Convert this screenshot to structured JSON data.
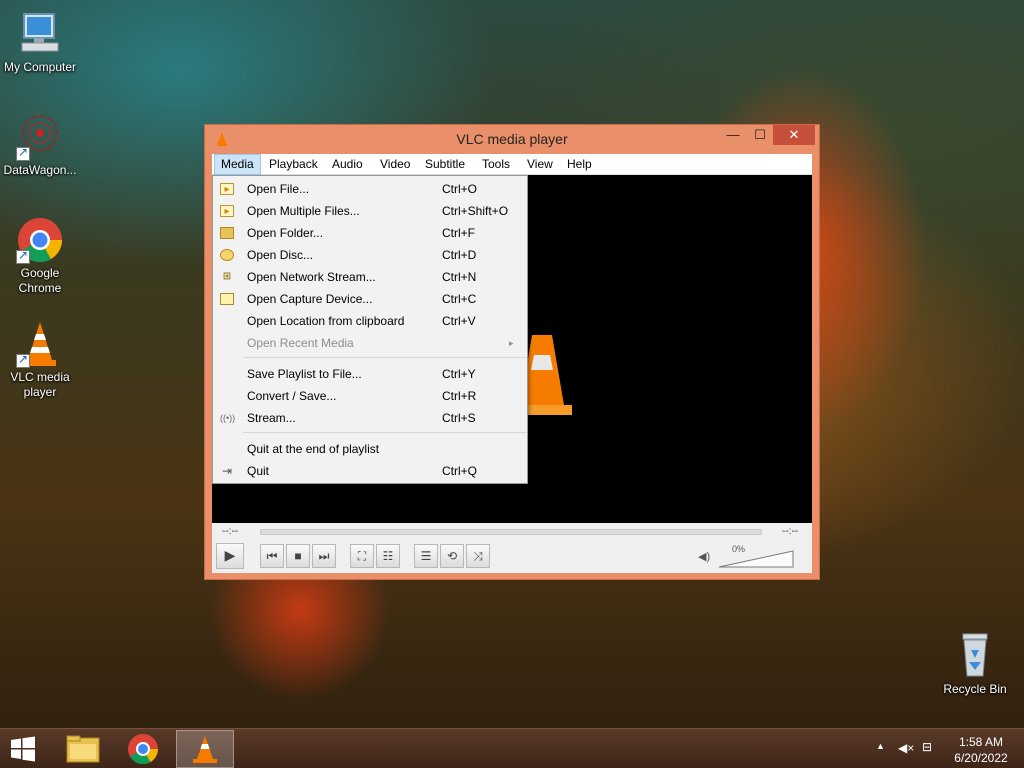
{
  "desktop": {
    "icons": [
      {
        "label": "My Computer"
      },
      {
        "label": "DataWagon..."
      },
      {
        "label": "Google Chrome"
      },
      {
        "label": "VLC media player"
      },
      {
        "label": "Recycle Bin"
      }
    ]
  },
  "window": {
    "title": "VLC media player",
    "min_glyph": "—",
    "max_glyph": "☐",
    "close_glyph": "✕"
  },
  "menubar": {
    "items": [
      "Media",
      "Playback",
      "Audio",
      "Video",
      "Subtitle",
      "Tools",
      "View",
      "Help"
    ],
    "active": "Media"
  },
  "media_menu": {
    "items": [
      {
        "label": "Open File...",
        "shortcut": "Ctrl+O",
        "icon": "file-icon"
      },
      {
        "label": "Open Multiple Files...",
        "shortcut": "Ctrl+Shift+O",
        "icon": "files-icon"
      },
      {
        "label": "Open Folder...",
        "shortcut": "Ctrl+F",
        "icon": "folder-icon"
      },
      {
        "label": "Open Disc...",
        "shortcut": "Ctrl+D",
        "icon": "disc-icon"
      },
      {
        "label": "Open Network Stream...",
        "shortcut": "Ctrl+N",
        "icon": "network-icon"
      },
      {
        "label": "Open Capture Device...",
        "shortcut": "Ctrl+C",
        "icon": "capture-icon"
      },
      {
        "label": "Open Location from clipboard",
        "shortcut": "Ctrl+V",
        "icon": ""
      },
      {
        "label": "Open Recent Media",
        "shortcut": "",
        "icon": "",
        "disabled": true,
        "submenu": "▸"
      },
      {
        "label": "Save Playlist to File...",
        "shortcut": "Ctrl+Y",
        "icon": ""
      },
      {
        "label": "Convert / Save...",
        "shortcut": "Ctrl+R",
        "icon": ""
      },
      {
        "label": "Stream...",
        "shortcut": "Ctrl+S",
        "icon": "stream-icon"
      },
      {
        "label": "Quit at the end of playlist",
        "shortcut": "",
        "icon": ""
      },
      {
        "label": "Quit",
        "shortcut": "Ctrl+Q",
        "icon": "quit-icon"
      }
    ]
  },
  "player": {
    "elapsed": "--:--",
    "remaining": "--:--",
    "volume": "0%",
    "volume_level": 0
  },
  "taskbar": {
    "clock_time": "1:58 AM",
    "clock_date": "6/20/2022"
  },
  "colors": {
    "window_frame": "#e9906a",
    "close_button": "#c7503c",
    "menu_active": "#cce4f7"
  }
}
